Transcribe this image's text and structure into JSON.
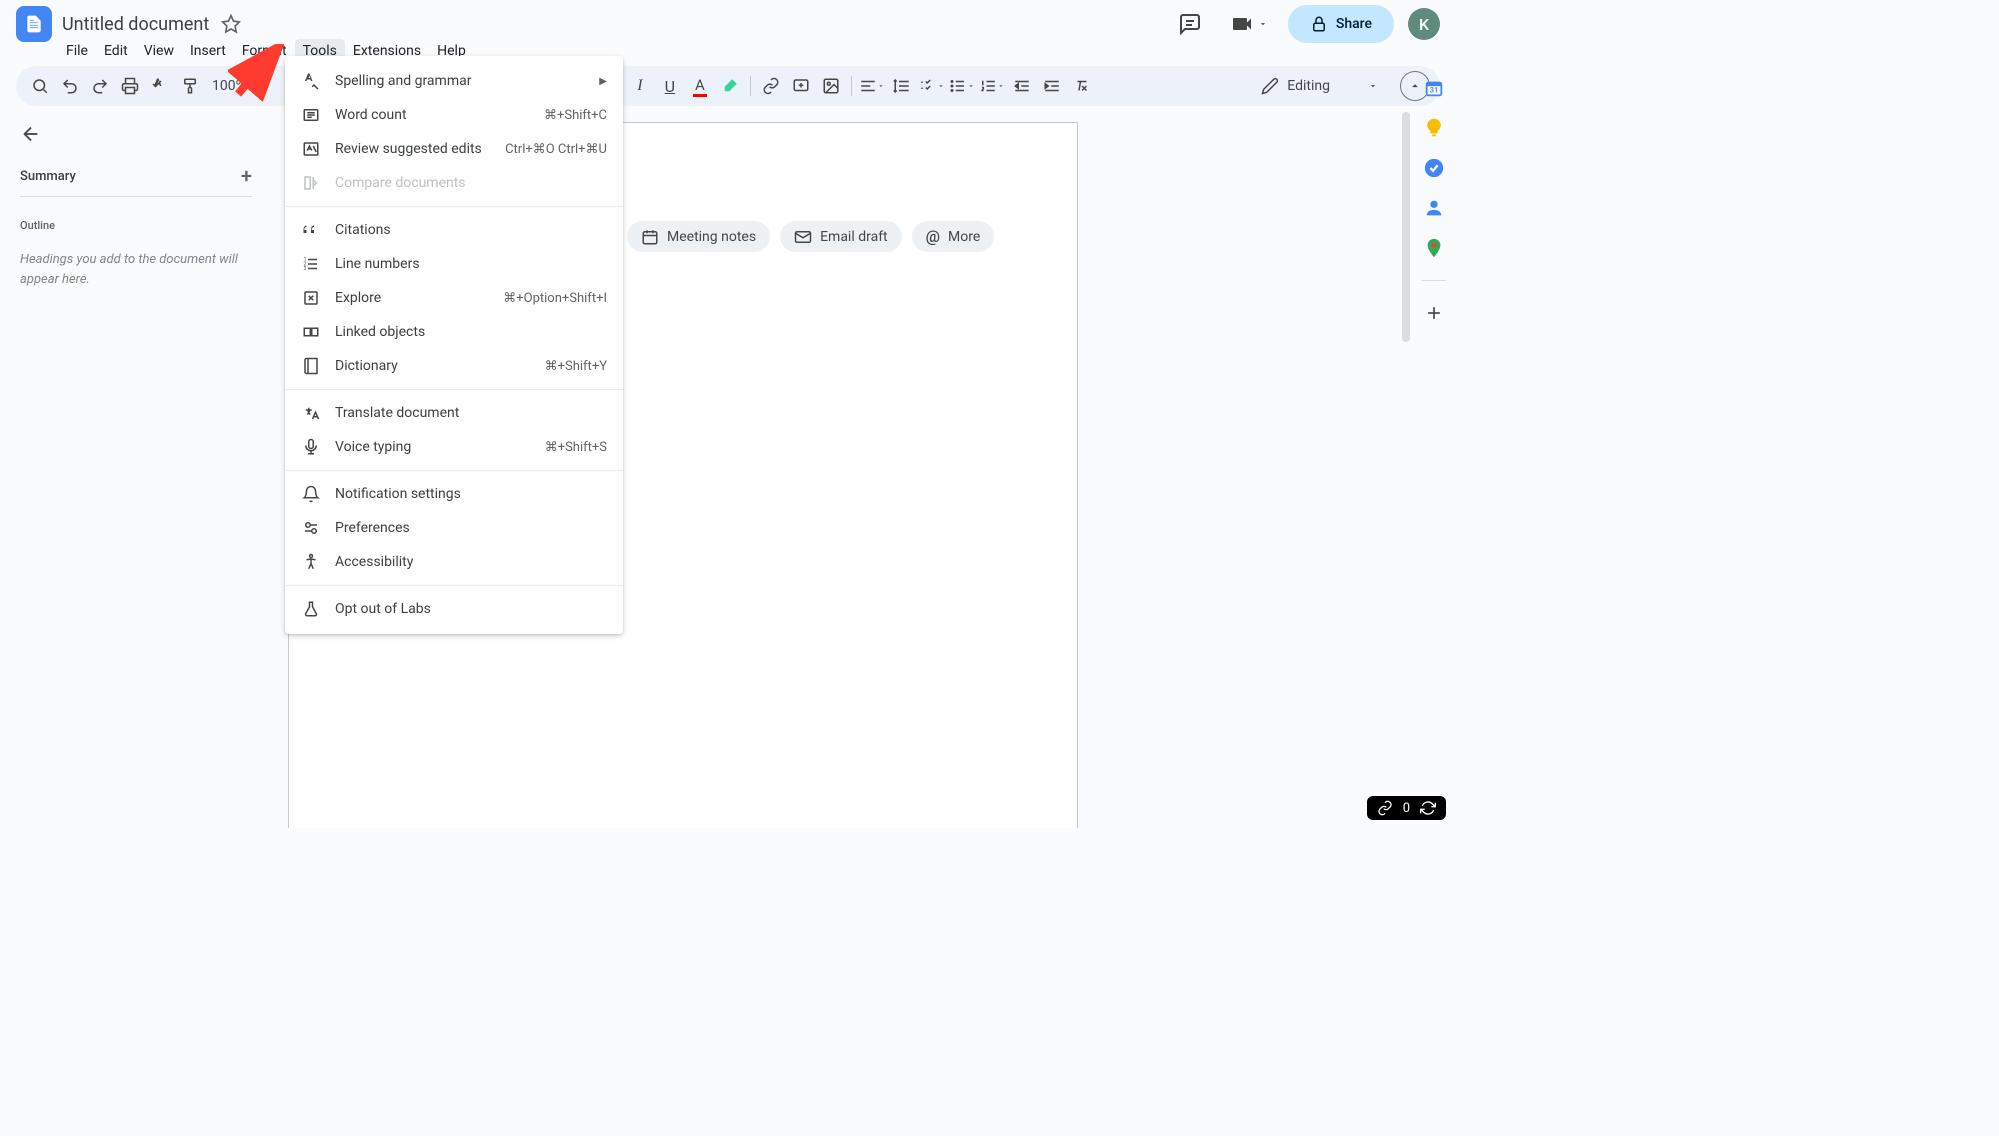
{
  "header": {
    "title": "Untitled document",
    "share_label": "Share",
    "avatar_letter": "K"
  },
  "menu": {
    "items": [
      "File",
      "Edit",
      "View",
      "Insert",
      "Format",
      "Tools",
      "Extensions",
      "Help"
    ],
    "active_index": 5
  },
  "toolbar": {
    "zoom": "100%",
    "mode": "Editing"
  },
  "sidebar": {
    "summary_label": "Summary",
    "outline_label": "Outline",
    "outline_hint": "Headings you add to the document will appear here."
  },
  "chips": {
    "meeting": "Meeting notes",
    "email": "Email draft",
    "more": "More"
  },
  "dropdown": {
    "groups": [
      [
        {
          "icon": "spell",
          "label": "Spelling and grammar",
          "shortcut": "",
          "submenu": true
        },
        {
          "icon": "wordcount",
          "label": "Word count",
          "shortcut": "⌘+Shift+C"
        },
        {
          "icon": "review",
          "label": "Review suggested edits",
          "shortcut": "Ctrl+⌘O Ctrl+⌘U"
        },
        {
          "icon": "compare",
          "label": "Compare documents",
          "shortcut": "",
          "disabled": true
        }
      ],
      [
        {
          "icon": "quote",
          "label": "Citations",
          "shortcut": ""
        },
        {
          "icon": "linenum",
          "label": "Line numbers",
          "shortcut": ""
        },
        {
          "icon": "explore",
          "label": "Explore",
          "shortcut": "⌘+Option+Shift+I"
        },
        {
          "icon": "linked",
          "label": "Linked objects",
          "shortcut": ""
        },
        {
          "icon": "dict",
          "label": "Dictionary",
          "shortcut": "⌘+Shift+Y"
        }
      ],
      [
        {
          "icon": "translate",
          "label": "Translate document",
          "shortcut": ""
        },
        {
          "icon": "mic",
          "label": "Voice typing",
          "shortcut": "⌘+Shift+S"
        }
      ],
      [
        {
          "icon": "bell",
          "label": "Notification settings",
          "shortcut": ""
        },
        {
          "icon": "prefs",
          "label": "Preferences",
          "shortcut": ""
        },
        {
          "icon": "access",
          "label": "Accessibility",
          "shortcut": ""
        }
      ],
      [
        {
          "icon": "labs",
          "label": "Opt out of Labs",
          "shortcut": ""
        }
      ]
    ]
  },
  "bottom": {
    "count": "0"
  }
}
